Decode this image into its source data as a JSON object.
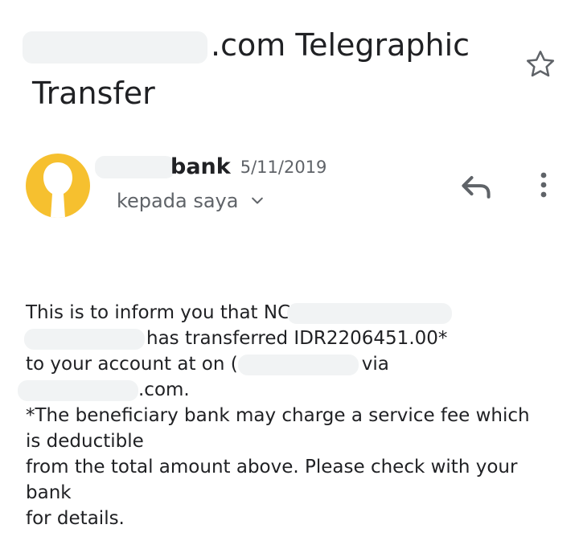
{
  "email": {
    "subject_line1": ".com Telegraphic",
    "subject_line2": "Transfer",
    "sender_name": "bank",
    "date": "5/11/2019",
    "recipient_label": "kepada saya",
    "body": {
      "line1": "This is to inform you that NC",
      "line2": "has transferred IDR2206451.00*",
      "line3a": "to your account at  on (",
      "line3b": "via",
      "line4": ".com.",
      "line5": "*The beneficiary bank may charge a service fee which",
      "line6": "is deductible",
      "line7": "from the total amount above. Please check with your",
      "line8": "bank",
      "line9": "for details."
    }
  },
  "icons": {
    "star": "star-outline-icon",
    "avatar": "person-silhouette",
    "chevron": "chevron-down-icon",
    "reply": "reply-icon",
    "more": "more-vert-icon"
  },
  "colors": {
    "avatar_bg": "#f6c02f",
    "text_primary": "#202124",
    "text_secondary": "#5f6368",
    "redaction": "#f1f3f4"
  }
}
